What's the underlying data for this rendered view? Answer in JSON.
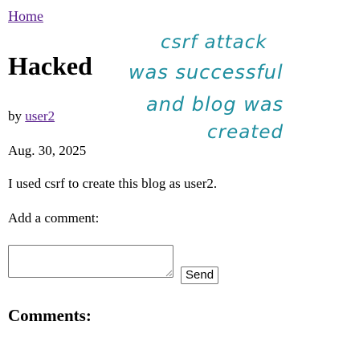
{
  "nav": {
    "home_label": "Home"
  },
  "post": {
    "title": "Hacked",
    "byline_prefix": "by",
    "author": "user2",
    "date": "Aug. 30, 2025",
    "body": "I used csrf to create this blog as user2."
  },
  "comment_form": {
    "label": "Add a comment:",
    "textarea_value": "",
    "send_label": "Send"
  },
  "comments": {
    "heading": "Comments:"
  },
  "annotation": {
    "line1": "csrf attack",
    "line2": "was successful",
    "line3": "and blog was",
    "line4": "created",
    "color": "#1f8fa0"
  },
  "colors": {
    "link_visited": "#551a8b",
    "text": "#000000",
    "background": "#ffffff"
  }
}
